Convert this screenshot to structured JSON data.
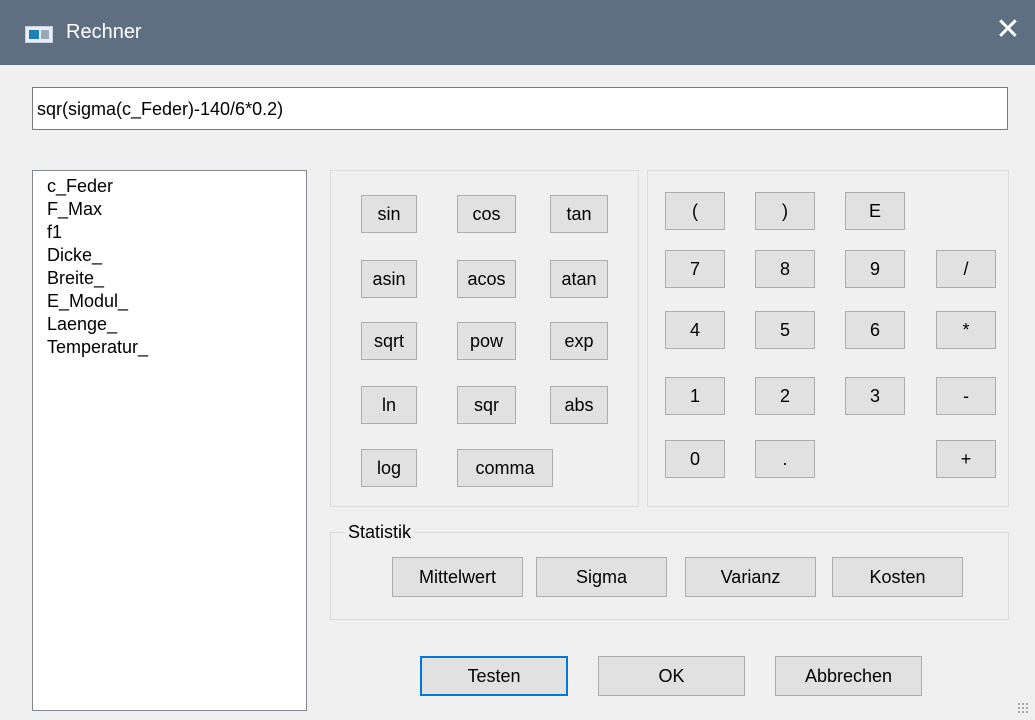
{
  "window": {
    "title": "Rechner",
    "close_glyph": "✕"
  },
  "formula": {
    "value": "sqr(sigma(c_Feder)-140/6*0.2)"
  },
  "variables": [
    "c_Feder",
    "F_Max",
    "f1",
    "Dicke_",
    "Breite_",
    "E_Modul_",
    "Laenge_",
    "Temperatur_"
  ],
  "functions": {
    "sin": "sin",
    "cos": "cos",
    "tan": "tan",
    "asin": "asin",
    "acos": "acos",
    "atan": "atan",
    "sqrt": "sqrt",
    "pow": "pow",
    "exp": "exp",
    "ln": "ln",
    "sqr": "sqr",
    "abs": "abs",
    "log": "log",
    "comma": "comma"
  },
  "keypad": {
    "lparen": "(",
    "rparen": ")",
    "e": "E",
    "n7": "7",
    "n8": "8",
    "n9": "9",
    "div": "/",
    "n4": "4",
    "n5": "5",
    "n6": "6",
    "mul": "*",
    "n1": "1",
    "n2": "2",
    "n3": "3",
    "sub": "-",
    "n0": "0",
    "dot": ".",
    "add": "+"
  },
  "statistik": {
    "legend": "Statistik",
    "mittelwert": "Mittelwert",
    "sigma": "Sigma",
    "varianz": "Varianz",
    "kosten": "Kosten"
  },
  "dialog": {
    "testen": "Testen",
    "ok": "OK",
    "abbrechen": "Abbrechen"
  },
  "icons": {
    "app": "calculator-window-icon",
    "close": "close-icon",
    "grip": "resize-grip-icon"
  }
}
